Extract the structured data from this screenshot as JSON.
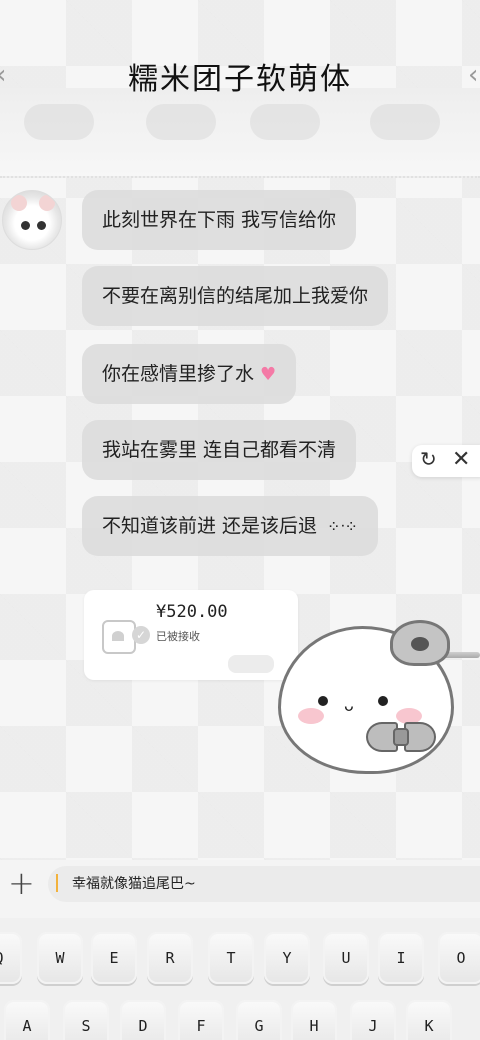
{
  "header": {
    "title": "糯米团子软萌体",
    "back_icon": "chevron-left-icon",
    "more_icon": "chevron-right-icon"
  },
  "messages": [
    {
      "text": "此刻世界在下雨 我写信给你"
    },
    {
      "text": "不要在离别信的结尾加上我爱你"
    },
    {
      "text": "你在感情里掺了水",
      "emoji": "♥"
    },
    {
      "text": "我站在雾里 连自己都看不清"
    },
    {
      "text": "不知道该前进 还是该后退",
      "emoji": "⁘ᐧ⁘"
    }
  ],
  "transfer": {
    "amount": "¥520.00",
    "status": "已被接收"
  },
  "side_tools": {
    "refresh_icon": "refresh-icon",
    "close_icon": "close-icon"
  },
  "input": {
    "plus_icon": "plus-icon",
    "value": "幸福就像猫追尾巴~"
  },
  "keyboard": {
    "row1": [
      "Q",
      "W",
      "E",
      "R",
      "T",
      "Y",
      "U",
      "I",
      "O"
    ],
    "row2": [
      "A",
      "S",
      "D",
      "F",
      "G",
      "H",
      "J",
      "K"
    ]
  },
  "colors": {
    "bubble": "#dddddd",
    "heart": "#f47aa6",
    "caret": "#f2b23c"
  }
}
